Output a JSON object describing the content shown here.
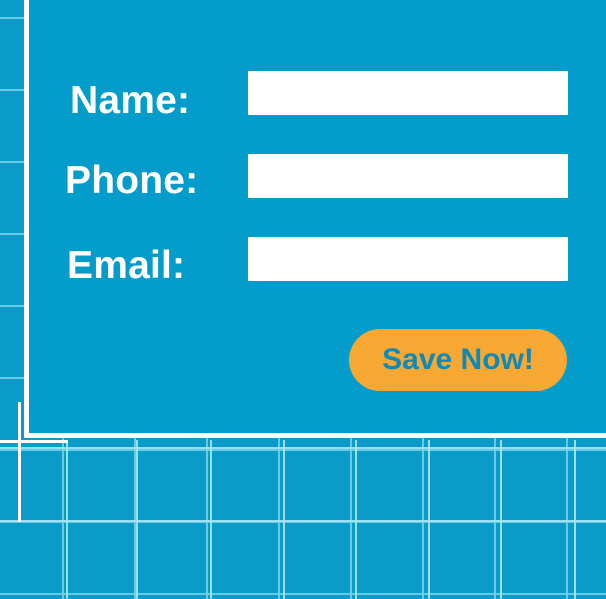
{
  "form": {
    "name_label": "Name:",
    "phone_label": "Phone:",
    "email_label": "Email:",
    "name_value": "",
    "phone_value": "",
    "email_value": "",
    "save_label": "Save Now!"
  },
  "colors": {
    "background": "#0a9bc8",
    "panel": "#049ccb",
    "grid_line": "#78d2eb",
    "button": "#f7a833",
    "button_text": "#0e89b8",
    "label_text": "#ffffff"
  }
}
